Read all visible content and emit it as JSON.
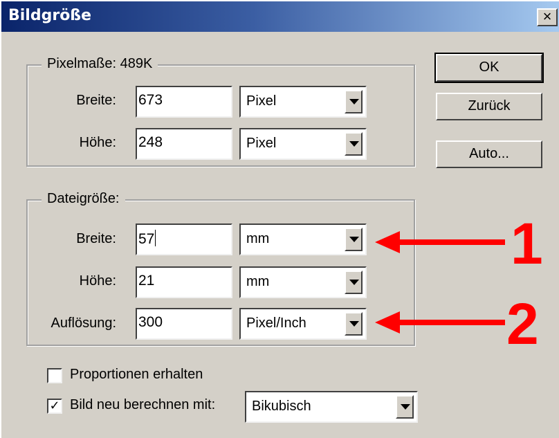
{
  "window": {
    "title": "Bildgröße",
    "close_glyph": "×"
  },
  "pixel_dimensions": {
    "legend": "Pixelmaße: 489K",
    "width_label": "Breite:",
    "width_value": "673",
    "width_unit": "Pixel",
    "height_label": "Höhe:",
    "height_value": "248",
    "height_unit": "Pixel"
  },
  "document_size": {
    "legend": "Dateigröße:",
    "width_label": "Breite:",
    "width_value": "57",
    "width_unit": "mm",
    "height_label": "Höhe:",
    "height_value": "21",
    "height_unit": "mm",
    "resolution_label": "Auflösung:",
    "resolution_value": "300",
    "resolution_unit": "Pixel/Inch"
  },
  "buttons": {
    "ok": "OK",
    "reset": "Zurück",
    "auto": "Auto..."
  },
  "options": {
    "constrain_label": "Proportionen erhalten",
    "constrain_checked": false,
    "resample_label": "Bild neu berechnen mit:",
    "resample_checked": true,
    "resample_method": "Bikubisch"
  },
  "annotations": {
    "marker_1": "1",
    "marker_2": "2",
    "color": "#ff0000"
  }
}
